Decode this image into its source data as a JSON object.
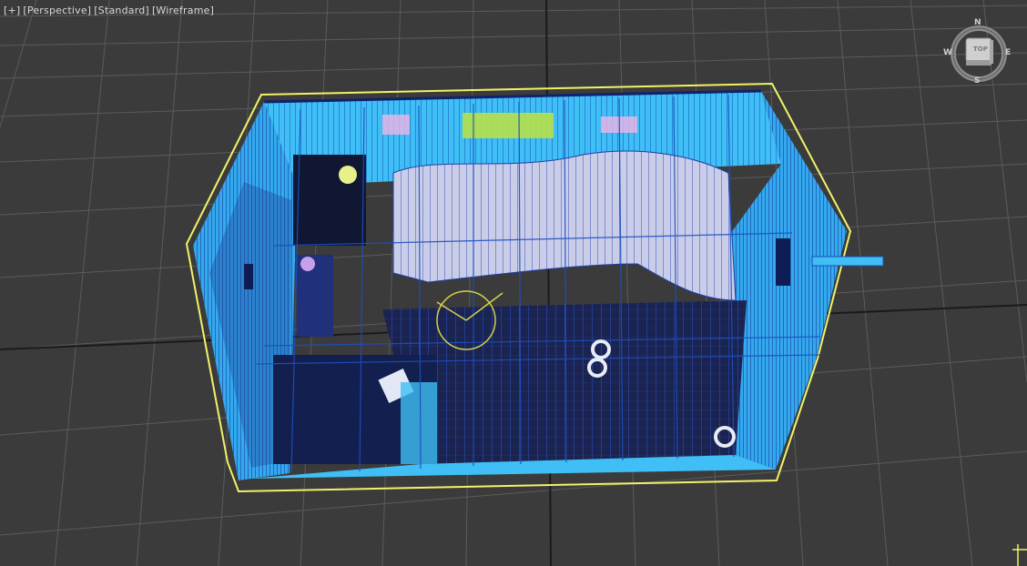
{
  "viewport": {
    "menu": {
      "plus": "[+]",
      "view": "[Perspective]",
      "shading_style": "[Standard]",
      "display_mode": "[Wireframe]"
    },
    "viewcube": {
      "face_label": "TOP",
      "north": "N",
      "south": "S",
      "east": "E",
      "west": "W"
    }
  },
  "colors": {
    "background": "#3b3b3b",
    "grid": "#5a5a5a",
    "grid_axis": "#1c1c1c",
    "selection_outline": "#f2f26a",
    "wire_cyan": "#3fbff5",
    "wire_blue": "#1c4fbf",
    "wire_white": "#c9cde8",
    "wire_dark": "#101a3a"
  }
}
